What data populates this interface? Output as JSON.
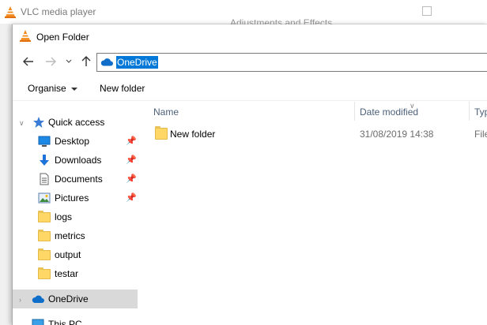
{
  "vlc": {
    "title": "VLC media player",
    "adjustments": "Adjustments and Effects"
  },
  "dialog": {
    "title": "Open Folder",
    "address": "OneDrive",
    "toolbar": {
      "organise": "Organise",
      "new_folder": "New folder"
    },
    "navigation": [
      {
        "label": "Quick access",
        "icon": "star-icon",
        "pinned": false
      },
      {
        "label": "Desktop",
        "icon": "desktop-icon",
        "pinned": true
      },
      {
        "label": "Downloads",
        "icon": "download-icon",
        "pinned": true
      },
      {
        "label": "Documents",
        "icon": "documents-icon",
        "pinned": true
      },
      {
        "label": "Pictures",
        "icon": "pictures-icon",
        "pinned": true
      },
      {
        "label": "logs",
        "icon": "folder-icon",
        "pinned": false
      },
      {
        "label": "metrics",
        "icon": "folder-icon",
        "pinned": false
      },
      {
        "label": "output",
        "icon": "folder-icon",
        "pinned": false
      },
      {
        "label": "testar",
        "icon": "folder-icon",
        "pinned": false
      },
      {
        "label": "OneDrive",
        "icon": "cloud-icon",
        "pinned": false,
        "selected": true
      },
      {
        "label": "This PC",
        "icon": "computer-icon",
        "pinned": false
      }
    ],
    "columns": {
      "name": "Name",
      "date_modified": "Date modified",
      "type": "Type"
    },
    "files": [
      {
        "name": "New folder",
        "date_modified": "31/08/2019 14:38",
        "type": "File"
      }
    ]
  },
  "colors": {
    "selection": "#0078d7",
    "folder": "#ffd766",
    "header_text": "#4c607a",
    "nav_selected": "#d9d9d9"
  }
}
